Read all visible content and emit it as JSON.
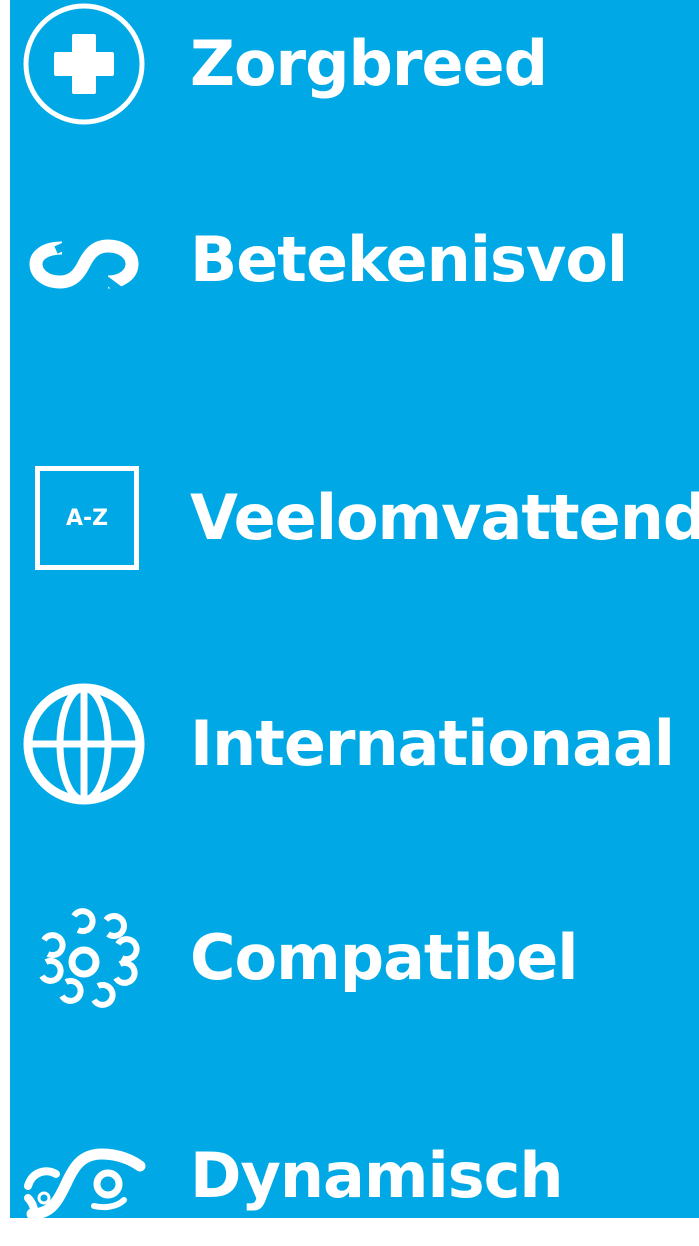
{
  "theme": {
    "background": "#00a9e6",
    "foreground": "#ffffff"
  },
  "features": [
    {
      "icon": "medical-cross-icon",
      "label": "Zorgbreed"
    },
    {
      "icon": "infinity-icon",
      "label": "Betekenisvol"
    },
    {
      "icon": "a-z-index-icon",
      "label": "Veelomvattend",
      "icon_text": "A-Z"
    },
    {
      "icon": "globe-icon",
      "label": "Internationaal"
    },
    {
      "icon": "linked-rings-icon",
      "label": "Compatibel"
    },
    {
      "icon": "wave-icon",
      "label": "Dynamisch"
    }
  ]
}
